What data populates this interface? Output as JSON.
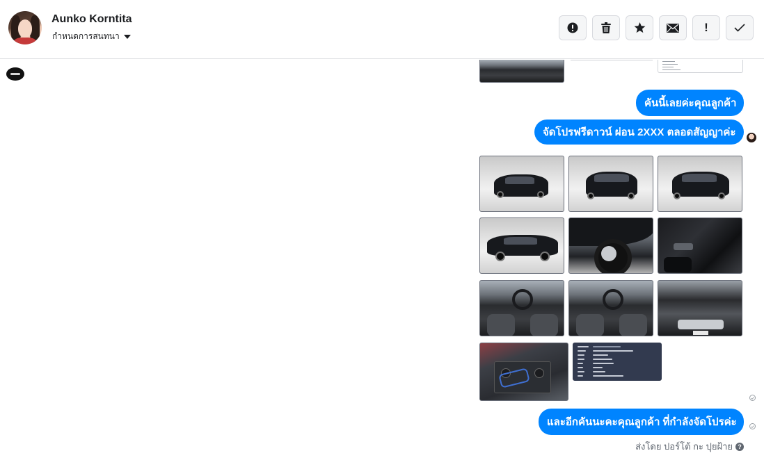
{
  "header": {
    "user_name": "Aunko Korntita",
    "assign_label": "กำหนดการสนทนา",
    "toolbar": [
      {
        "name": "spam-button",
        "icon": "alert-circle-icon"
      },
      {
        "name": "delete-button",
        "icon": "trash-icon"
      },
      {
        "name": "star-button",
        "icon": "star-icon"
      },
      {
        "name": "mark-unread-button",
        "icon": "envelope-icon"
      },
      {
        "name": "follow-up-button",
        "icon": "exclamation-icon",
        "label": "!"
      },
      {
        "name": "mark-done-button",
        "icon": "check-icon"
      }
    ]
  },
  "messages": [
    {
      "text": "คันนี้เลยค่ะคุณลูกค้า"
    },
    {
      "text": "จัดโปรฟรีดาวน์ ผ่อน 2XXX ตลอดสัญญาค่ะ"
    },
    {
      "text": "และอีกคันนะคะคุณลูกค้า ที่กำลังจัดโปรค่ะ"
    }
  ],
  "photos": [
    {
      "subject": "car-front-three-quarter"
    },
    {
      "subject": "car-rear"
    },
    {
      "subject": "car-rear-three-quarter"
    },
    {
      "subject": "car-side"
    },
    {
      "subject": "wheel-closeup"
    },
    {
      "subject": "door-interior"
    },
    {
      "subject": "dashboard"
    },
    {
      "subject": "dashboard-2"
    },
    {
      "subject": "engine-bay"
    },
    {
      "subject": "battery"
    },
    {
      "subject": "registration-document"
    }
  ],
  "footer": {
    "sent_by": "ส่งโดย ปอร์โต้ กะ ปุยฝ้าย",
    "help_glyph": "?"
  },
  "colors": {
    "bubble": "#0084ff",
    "header_border": "#dddfe2",
    "muted_text": "#606770"
  }
}
